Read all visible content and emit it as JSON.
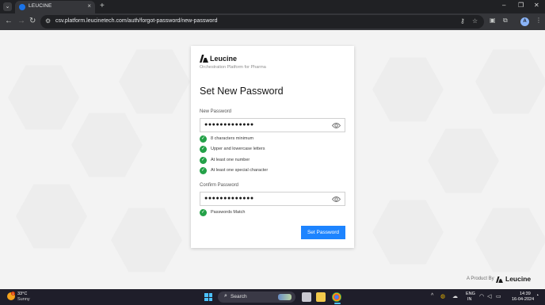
{
  "browser": {
    "tab_title": "LEUCINE",
    "tab_close": "×",
    "new_tab": "+",
    "url": "csv.platform.leucinetech.com/auth/forgot-password/new-password",
    "profile_initial": "A",
    "window_controls": {
      "minimize": "–",
      "maximize": "❐",
      "close": "✕"
    }
  },
  "brand": {
    "name": "Leucine",
    "tagline": "Orchestration Platform for Pharma",
    "color": "#161616"
  },
  "form": {
    "heading": "Set New Password",
    "new_password": {
      "label": "New Password",
      "value": "●●●●●●●●●●●●●",
      "requirements": [
        {
          "text": "8 characters minimum",
          "met": true
        },
        {
          "text": "Upper and lowercase letters",
          "met": true
        },
        {
          "text": "At least one number",
          "met": true
        },
        {
          "text": "At least one special character",
          "met": true
        }
      ]
    },
    "confirm_password": {
      "label": "Confirm Password",
      "value": "●●●●●●●●●●●●●",
      "match_text": "Passwords Match"
    },
    "submit_label": "Set Password",
    "check_glyph": "✓"
  },
  "footer": {
    "product_by": "A Product By",
    "brand": "Leucine"
  },
  "taskbar": {
    "weather_temp": "33°C",
    "weather_condition": "Sunny",
    "weather_badge": "1",
    "search_placeholder": "Search",
    "language": "ENG",
    "region": "IN",
    "time": "14:39",
    "date": "16-04-2024"
  },
  "colors": {
    "accent": "#1d84ff",
    "success": "#24a148"
  }
}
